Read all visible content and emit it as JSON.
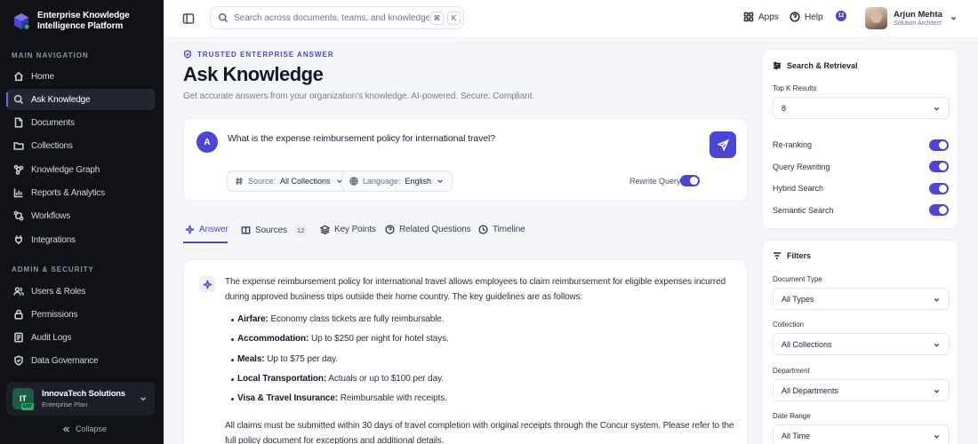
{
  "brand": {
    "title": "Enterprise Knowledge Intelligence Platform"
  },
  "sidebar": {
    "main_label": "MAIN NAVIGATION",
    "main_items": [
      {
        "label": "Home",
        "icon": "home-icon"
      },
      {
        "label": "Ask Knowledge",
        "icon": "search-icon",
        "active": true
      },
      {
        "label": "Documents",
        "icon": "document-icon"
      },
      {
        "label": "Collections",
        "icon": "folder-icon"
      },
      {
        "label": "Knowledge Graph",
        "icon": "graph-icon"
      },
      {
        "label": "Reports & Analytics",
        "icon": "chart-icon"
      },
      {
        "label": "Workflows",
        "icon": "workflow-icon"
      },
      {
        "label": "Integrations",
        "icon": "plug-icon"
      }
    ],
    "admin_label": "ADMIN & SECURITY",
    "admin_items": [
      {
        "label": "Users & Roles",
        "icon": "users-icon"
      },
      {
        "label": "Permissions",
        "icon": "lock-icon"
      },
      {
        "label": "Audit Logs",
        "icon": "log-icon"
      },
      {
        "label": "Data Governance",
        "icon": "shield-icon"
      }
    ],
    "org": {
      "initials": "IT",
      "badge": "ENT",
      "name": "InnovaTech Solutions",
      "plan": "Enterprise Plan"
    },
    "collapse_label": "Collapse"
  },
  "topbar": {
    "search_placeholder": "Search across documents, teams, and knowledge...",
    "kbd_cmd": "⌘",
    "kbd_key": "K",
    "apps_label": "Apps",
    "help_label": "Help",
    "notif_count": "12",
    "user_name": "Arjun Mehta",
    "user_role": "Solution Architect"
  },
  "header": {
    "eyebrow": "TRUSTED ENTERPRISE ANSWER",
    "title": "Ask Knowledge",
    "subtitle": "Get accurate answers from your organization's knowledge. AI-powered. Secure. Compliant."
  },
  "query": {
    "avatar": "A",
    "text": "What is the expense reimbursement policy for international travel?",
    "source_label": "Source:",
    "source_value": "All Collections",
    "language_label": "Language:",
    "language_value": "English",
    "rewrite_label": "Rewrite Query",
    "rewrite_on": true
  },
  "tabs": [
    {
      "label": "Answer",
      "active": true
    },
    {
      "label": "Sources",
      "count": "12"
    },
    {
      "label": "Key Points"
    },
    {
      "label": "Related Questions"
    },
    {
      "label": "Timeline"
    }
  ],
  "answer": {
    "intro": "The expense reimbursement policy for international travel allows employees to claim reimbursement for eligible expenses incurred during approved business trips outside their home country. The key guidelines are as follows:",
    "bullets": [
      {
        "term": "Airfare:",
        "text": " Economy class tickets are fully reimbursable."
      },
      {
        "term": "Accommodation:",
        "text": " Up to $250 per night for hotel stays."
      },
      {
        "term": "Meals:",
        "text": " Up to $75 per day."
      },
      {
        "term": "Local Transportation:",
        "text": " Actuals or up to $100 per day."
      },
      {
        "term": "Visa & Travel Insurance:",
        "text": " Reimbursable with receipts."
      }
    ],
    "closing": "All claims must be submitted within 30 days of travel completion with original receipts through the Concur system. Please refer to the full policy document for exceptions and additional details."
  },
  "retrieval": {
    "title": "Search & Retrieval",
    "topk_label": "Top K Results",
    "topk_value": "8",
    "options": [
      {
        "label": "Re-ranking",
        "on": true
      },
      {
        "label": "Query Rewriting",
        "on": true
      },
      {
        "label": "Hybrid Search",
        "on": true
      },
      {
        "label": "Semantic Search",
        "on": true
      }
    ]
  },
  "filters": {
    "title": "Filters",
    "doc_type_label": "Document Type",
    "doc_type_value": "All Types",
    "collection_label": "Collection",
    "collection_value": "All Collections",
    "department_label": "Department",
    "department_value": "All Departments",
    "date_label": "Date Range",
    "date_value": "All Time"
  },
  "colors": {
    "accent": "#4b46d6",
    "sidebar_bg": "#101217",
    "page_bg": "#f4f5f8"
  }
}
